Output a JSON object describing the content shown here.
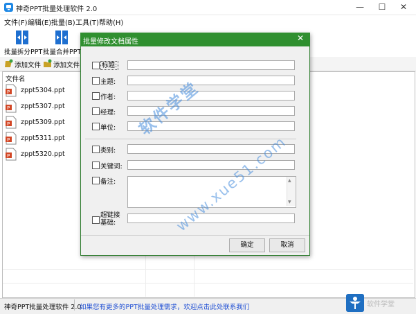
{
  "window": {
    "title": "神奇PPT批量处理软件 2.0",
    "controls": [
      "—",
      "☐",
      "✕"
    ]
  },
  "menu": [
    {
      "label": "文件(F)"
    },
    {
      "label": "编辑(E)"
    },
    {
      "label": "批量(B)"
    },
    {
      "label": "工具(T)"
    },
    {
      "label": "帮助(H)"
    }
  ],
  "toolbar": {
    "split_label": "批量拆分PPT",
    "merge_label": "批量合并PPT"
  },
  "toolbar2": {
    "add_file_label": "添加文件",
    "add_folder_label": "添加文件夹"
  },
  "file_list": {
    "column_header": "文件名",
    "files": [
      "zppt5304.ppt",
      "zppt5307.ppt",
      "zppt5309.ppt",
      "zppt5311.ppt",
      "zppt5320.ppt"
    ]
  },
  "status": {
    "app_name": "神奇PPT批量处理软件 2.0",
    "link_text": "如果您有更多的PPT批量处理需求，欢迎点击此处联系我们"
  },
  "dialog": {
    "title": "批量修改文档属性",
    "close": "✕",
    "fields": {
      "title": "标题:",
      "subject": "主题:",
      "author": "作者:",
      "manager": "经理:",
      "company": "单位:",
      "category": "类别:",
      "keywords": "关键词:",
      "remarks": "备注:",
      "hyperlink_line1": "超链接",
      "hyperlink_line2": "基础:"
    },
    "ok_label": "确定",
    "cancel_label": "取消"
  },
  "watermark": {
    "line1": "软件学堂",
    "line2": "www.xue51.com"
  },
  "corner_watermark": "软件学堂",
  "colors": {
    "dialog_title_bg": "#2f8f2f",
    "status_link": "#1f4fd4",
    "watermark": "#468cdc"
  }
}
